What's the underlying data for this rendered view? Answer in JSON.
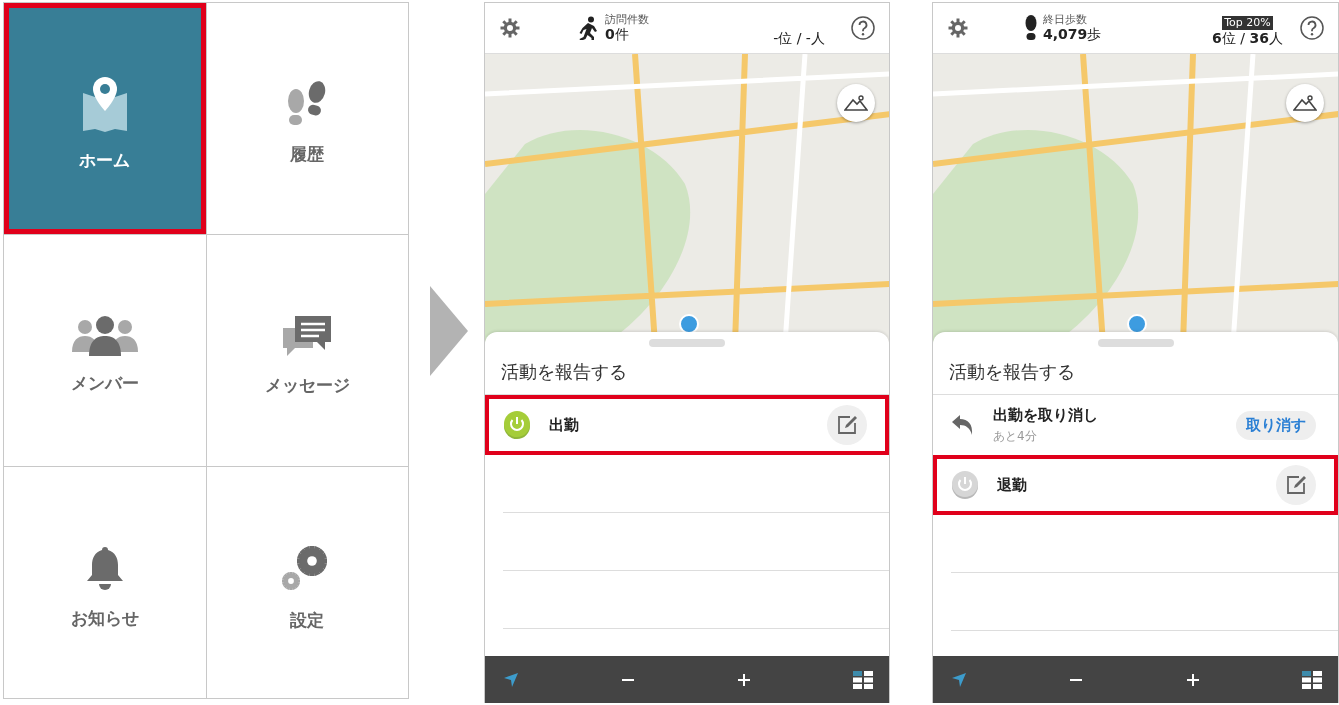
{
  "menu": {
    "items": [
      {
        "label": "ホーム",
        "selected": true,
        "highlighted": true
      },
      {
        "label": "履歴",
        "selected": false,
        "highlighted": false
      },
      {
        "label": "メンバー",
        "selected": false,
        "highlighted": false
      },
      {
        "label": "メッセージ",
        "selected": false,
        "highlighted": false
      },
      {
        "label": "お知らせ",
        "selected": false,
        "highlighted": false
      },
      {
        "label": "設定",
        "selected": false,
        "highlighted": false
      }
    ]
  },
  "screens": [
    {
      "header": {
        "stat_label": "訪問件数",
        "stat_value": "**0**件",
        "rank": "-位 / -人"
      },
      "sheet": {
        "title": "活動を報告する",
        "rows": [
          {
            "kind": "action",
            "label": "出勤",
            "enabled": true,
            "highlighted": true
          }
        ]
      }
    },
    {
      "header": {
        "stat_label": "終日歩数",
        "stat_value": "**4,079**歩",
        "badge": "Top 20%",
        "rank": "**6**位 / **36**人"
      },
      "sheet": {
        "title": "活動を報告する",
        "rows": [
          {
            "kind": "undo",
            "label": "出勤を取り消し",
            "sublabel": "あと4分",
            "button": "取り消す",
            "highlighted": false
          },
          {
            "kind": "action",
            "label": "退勤",
            "enabled": false,
            "highlighted": true
          }
        ]
      }
    }
  ]
}
